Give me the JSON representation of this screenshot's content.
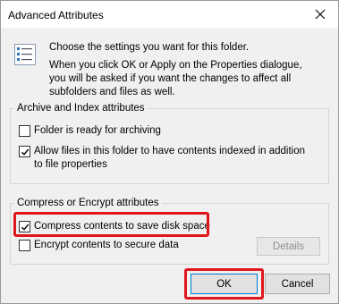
{
  "window": {
    "title": "Advanced Attributes",
    "close_icon": "close-icon"
  },
  "intro": {
    "icon": "settings-list-icon",
    "line1": "Choose the settings you want for this folder.",
    "line2": "When you click OK or Apply on the Properties dialogue, you will be asked if you want the changes to affect all subfolders and files as well."
  },
  "archive_group": {
    "legend": "Archive and Index attributes",
    "folder_ready": {
      "label": "Folder is ready for archiving",
      "checked": false
    },
    "allow_index": {
      "label": "Allow files in this folder to have contents indexed in addition to file properties",
      "checked": true
    }
  },
  "compress_group": {
    "legend": "Compress or Encrypt attributes",
    "compress": {
      "label": "Compress contents to save disk space",
      "checked": true
    },
    "encrypt": {
      "label": "Encrypt contents to secure data",
      "checked": false
    },
    "details_label": "Details"
  },
  "buttons": {
    "ok": "OK",
    "cancel": "Cancel"
  },
  "colors": {
    "highlight": "#e0161b",
    "default_button_border": "#0078d7",
    "window_bg": "#f0f0f0"
  }
}
